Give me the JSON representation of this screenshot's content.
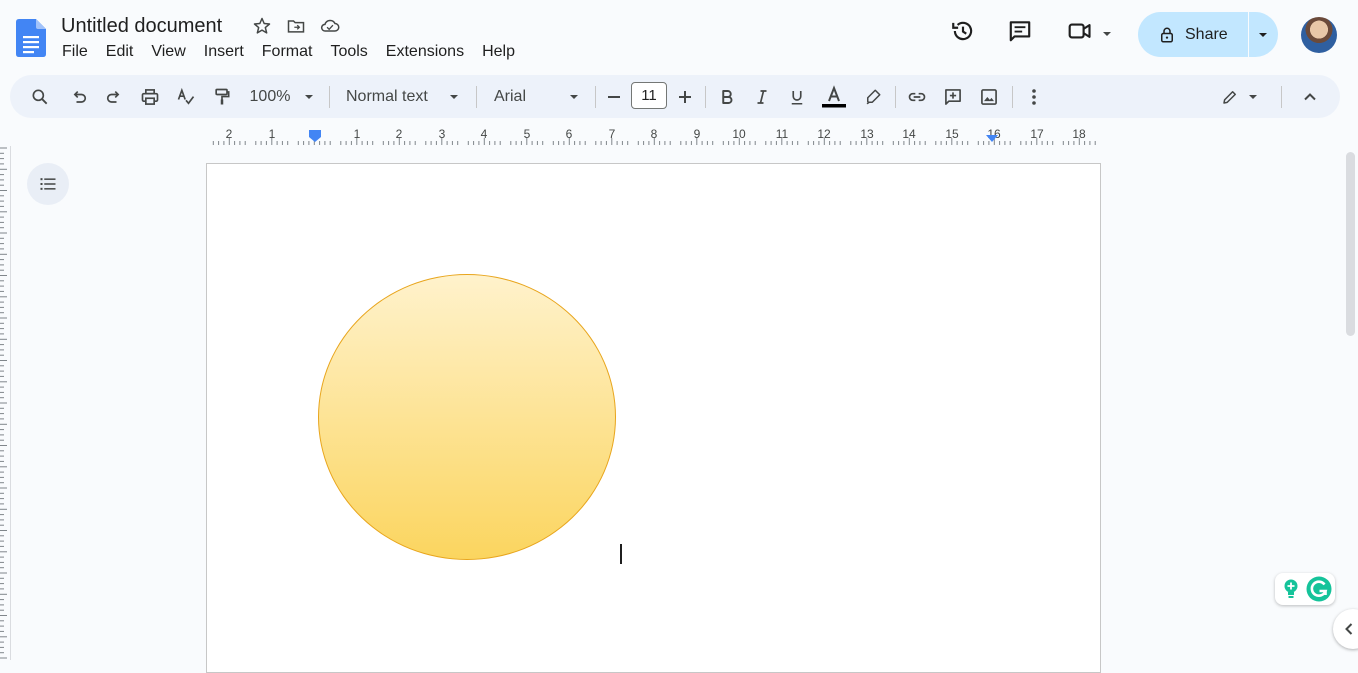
{
  "app": {
    "title": "Untitled document"
  },
  "menu": {
    "items": [
      "File",
      "Edit",
      "View",
      "Insert",
      "Format",
      "Tools",
      "Extensions",
      "Help"
    ]
  },
  "header": {
    "share_label": "Share"
  },
  "toolbar": {
    "zoom": "100%",
    "style": "Normal text",
    "font": "Arial",
    "font_size": "11"
  },
  "ruler": {
    "labels": [
      "2",
      "1",
      "1",
      "2",
      "3",
      "4",
      "5",
      "6",
      "7",
      "8",
      "9",
      "10",
      "11",
      "12",
      "13",
      "14",
      "15",
      "16",
      "17",
      "18"
    ]
  },
  "colors": {
    "accent": "#c2e7ff",
    "doc_blue": "#4285f4",
    "shape_fill_top": "#fff2cc",
    "shape_fill_bottom": "#fbd55f",
    "shape_border": "#e8a51c",
    "grammarly_green": "#15c39a"
  }
}
